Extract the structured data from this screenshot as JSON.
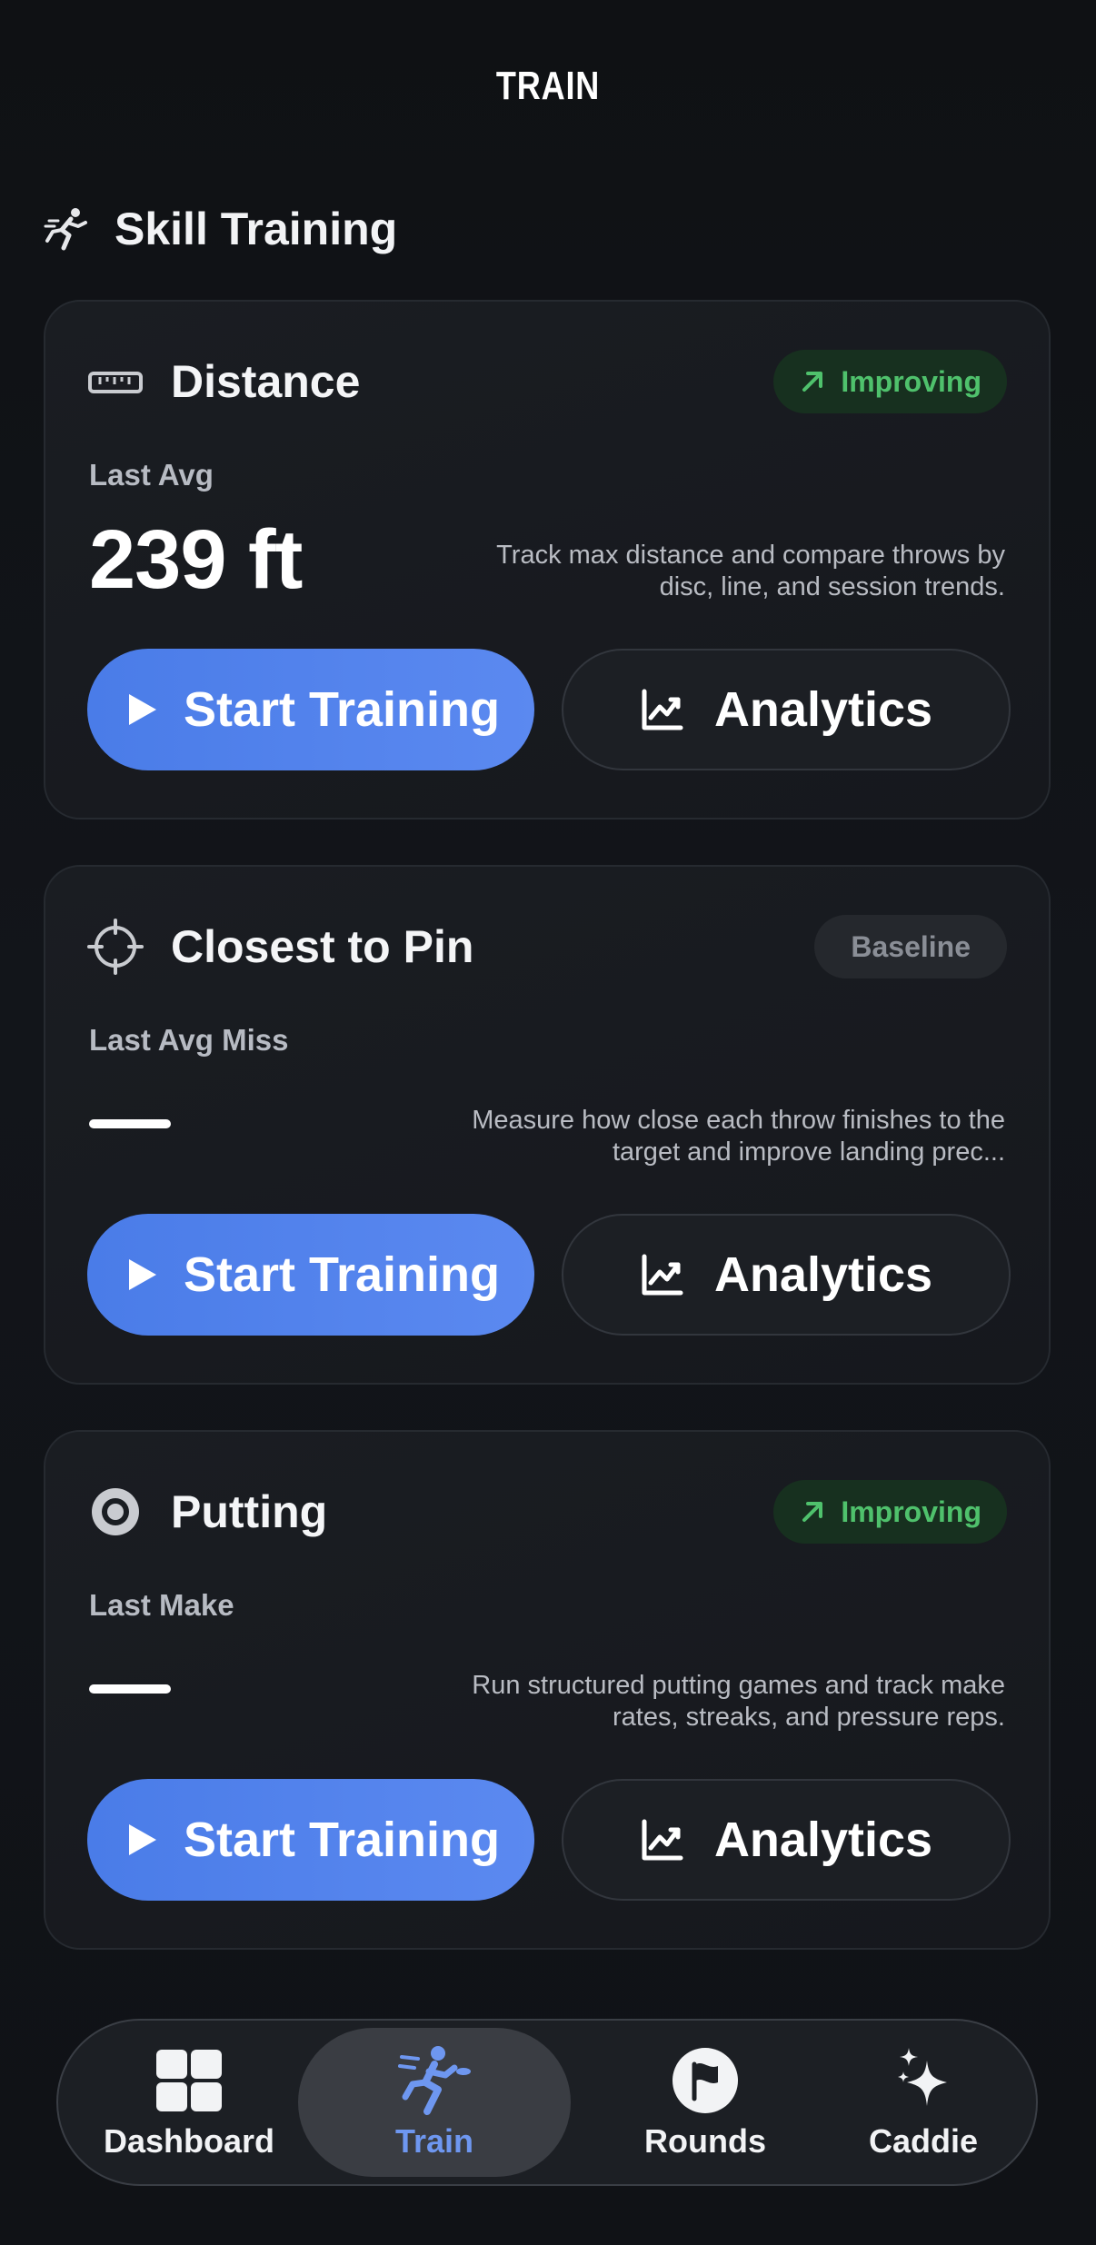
{
  "header": {
    "title": "TRAIN"
  },
  "section": {
    "title": "Skill Training",
    "icon": "runner-icon"
  },
  "cards": [
    {
      "title": "Distance",
      "icon": "ruler-icon",
      "badge": "Improving",
      "metric_label": "Last Avg",
      "metric_value": "239 ft",
      "description": "Track max distance and compare throws by disc, line, and session trends.",
      "start_label": "Start Training",
      "analytics_label": "Analytics"
    },
    {
      "title": "Closest to Pin",
      "icon": "crosshair-icon",
      "badge": "Baseline",
      "metric_label": "Last Avg Miss",
      "metric_value": "",
      "description": "Measure how close each throw finishes to the target and improve landing prec...",
      "start_label": "Start Training",
      "analytics_label": "Analytics"
    },
    {
      "title": "Putting",
      "icon": "target-icon",
      "badge": "Improving",
      "metric_label": "Last Make",
      "metric_value": "",
      "description": "Run structured putting games and track make rates, streaks, and pressure reps.",
      "start_label": "Start Training",
      "analytics_label": "Analytics"
    }
  ],
  "tabbar": {
    "items": [
      {
        "label": "Dashboard",
        "icon": "grid-icon",
        "active": false
      },
      {
        "label": "Train",
        "icon": "runner-icon",
        "active": true
      },
      {
        "label": "Rounds",
        "icon": "flag-icon",
        "active": false
      },
      {
        "label": "Caddie",
        "icon": "sparkle-icon",
        "active": false
      }
    ]
  },
  "colors": {
    "accent": "#4a7ce8",
    "improving": "#4fc16c",
    "improving_bg": "#17301f",
    "active_tab_label": "#6e97f0"
  }
}
